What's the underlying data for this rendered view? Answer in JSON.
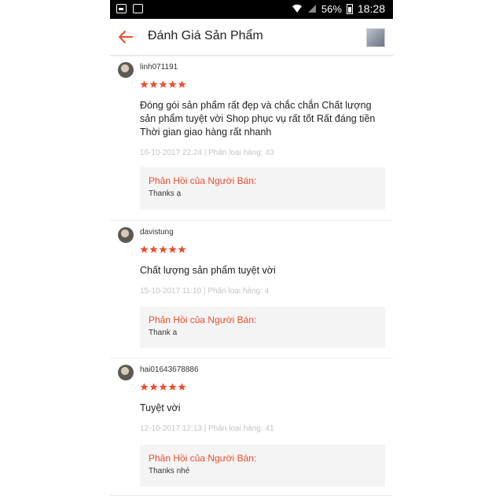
{
  "status_bar": {
    "battery": "56%",
    "time": "18:28"
  },
  "header": {
    "title": "Đánh Giá Sản Phẩm"
  },
  "colors": {
    "accent": "#ee4d2d",
    "star": "#ee4d2d"
  },
  "reviews": [
    {
      "username": "linh071191",
      "rating": 5,
      "text": "Đóng gói sản phẩm rất đẹp và chắc chắn Chất lượng sản phẩm tuyệt vời Shop phục vụ rất tốt Rất đáng tiền Thời gian giao hàng rất nhanh",
      "meta": "16-10-2017 22:24 | Phân loại hàng: 43",
      "seller_label": "Phản Hồi của Người Bán:",
      "seller_reply": "Thanks ạ"
    },
    {
      "username": "davistung",
      "rating": 5,
      "text": "Chất lượng sản phẩm tuyệt vời",
      "meta": "15-10-2017 11:10 | Phân loại hàng: 4",
      "seller_label": "Phản Hồi của Người Bán:",
      "seller_reply": "Thank a"
    },
    {
      "username": "hai01643678886",
      "rating": 5,
      "text": "Tuyệt vời",
      "meta": "12-10-2017 12:13 | Phân loại hàng: 41",
      "seller_label": "Phản Hồi của Người Bán:",
      "seller_reply": "Thanks nhé"
    }
  ]
}
